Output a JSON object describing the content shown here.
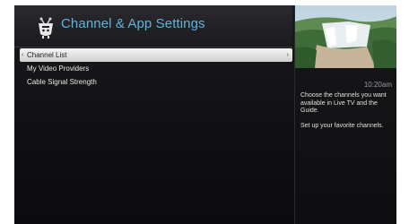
{
  "header": {
    "title": "Channel & App Settings",
    "logo_icon": "tivo-logo-icon"
  },
  "menu": {
    "items": [
      {
        "label": "Channel List",
        "selected": true
      },
      {
        "label": "My Video Providers",
        "selected": false
      },
      {
        "label": "Cable Signal Strength",
        "selected": false
      }
    ]
  },
  "info_panel": {
    "time": "10:20am",
    "description_lines": [
      "Choose the channels you want available in Live TV and the Guide.",
      "Set up your favorite channels."
    ],
    "preview_icon": "waterfall-landscape-preview"
  },
  "colors": {
    "title": "#5fb3d9",
    "background": "#111113",
    "highlight": "#e8e8e8"
  }
}
